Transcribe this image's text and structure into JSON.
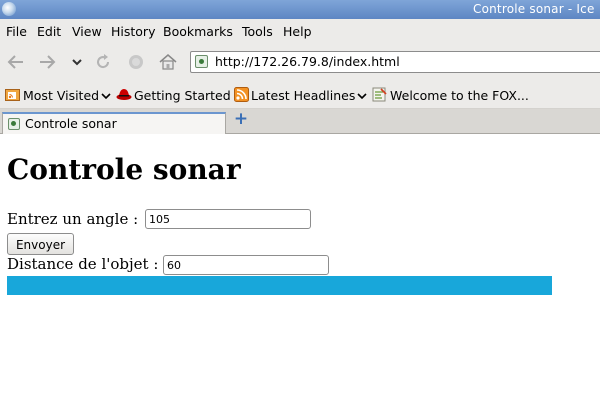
{
  "window": {
    "title": "Controle sonar - Ice"
  },
  "menubar": {
    "items": [
      {
        "label": "File"
      },
      {
        "label": "Edit"
      },
      {
        "label": "View"
      },
      {
        "label": "History"
      },
      {
        "label": "Bookmarks"
      },
      {
        "label": "Tools"
      },
      {
        "label": "Help"
      }
    ]
  },
  "navbar": {
    "url": "http://172.26.79.8/index.html",
    "icons": [
      "back-arrow-icon",
      "forward-arrow-icon",
      "history-dropdown-icon",
      "reload-icon",
      "stop-icon",
      "home-icon"
    ]
  },
  "bookmarks": {
    "items": [
      {
        "label": "Most Visited",
        "icon": "rss-folder-icon"
      },
      {
        "label": "Getting Started",
        "icon": "redhat-icon"
      },
      {
        "label": "Latest Headlines",
        "icon": "rss-icon"
      },
      {
        "label": "Welcome to the FOX...",
        "icon": "fox-icon"
      }
    ]
  },
  "tabs": [
    {
      "label": "Controle sonar"
    }
  ],
  "page": {
    "heading": "Controle sonar",
    "angle_label": "Entrez un angle :",
    "angle_value": "105",
    "submit_label": "Envoyer",
    "distance_label": "Distance de l'objet :",
    "distance_value": "60",
    "distance_bar": {
      "fraction": 1.0,
      "color": "#18a7da"
    }
  }
}
